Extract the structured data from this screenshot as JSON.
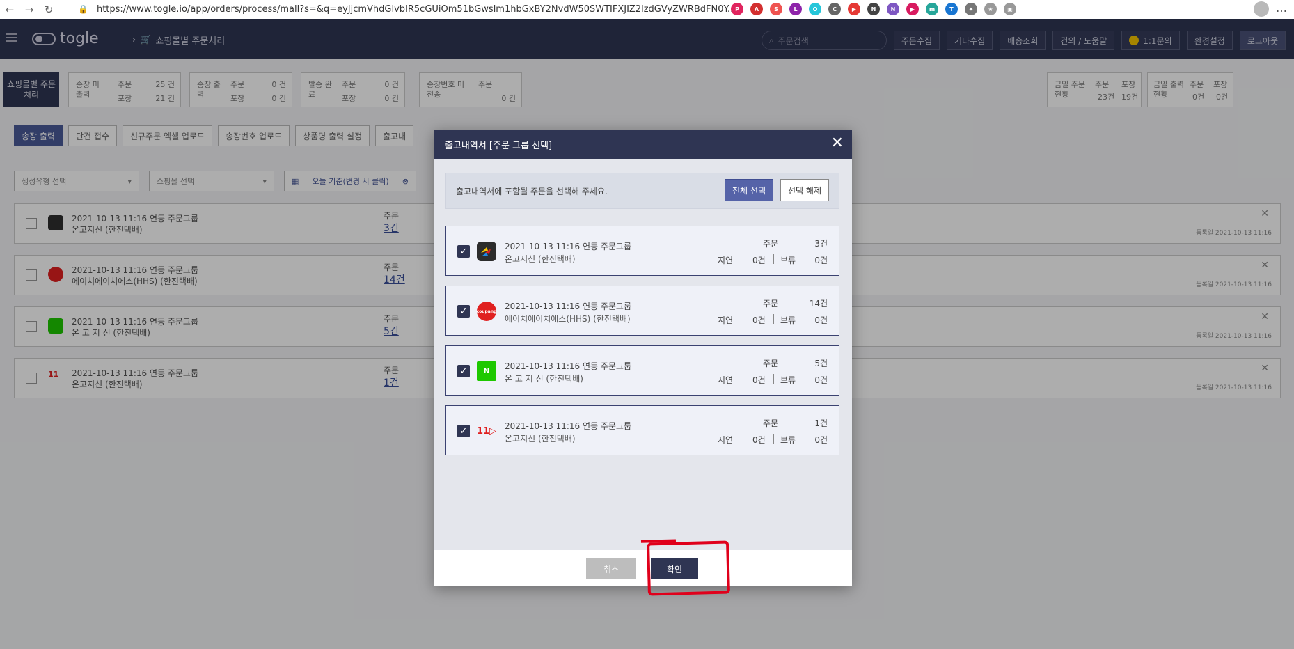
{
  "browser": {
    "url": "https://www.togle.io/app/orders/process/mall?s=&q=eyJjcmVhdGlvbIR5cGUiOm51bGwslm1hbGxBY2NvdW50SWTIFXJIZ2lzdGVyZWRBdFN0Y..."
  },
  "header": {
    "logo": "togle",
    "breadcrumb": "쇼핑몰별 주문처리",
    "search_placeholder": "주문검색",
    "buttons": [
      "주문수집",
      "기타수집",
      "배송조회",
      "건의 / 도움말",
      "1:1문의",
      "환경설정",
      "로그아웃"
    ]
  },
  "status": {
    "main_label": "쇼핑몰별 주문처리",
    "cards": [
      {
        "label": "송장 미출력",
        "r1_label": "주문",
        "r1_value": "25 건",
        "r2_label": "포장",
        "r2_value": "21 건"
      },
      {
        "label": "송장 출력",
        "r1_label": "주문",
        "r1_value": "0 건",
        "r2_label": "포장",
        "r2_value": "0 건"
      },
      {
        "label": "발송 완료",
        "r1_label": "주문",
        "r1_value": "0 건",
        "r2_label": "포장",
        "r2_value": "0 건"
      },
      {
        "label": "송장번호 미전송",
        "r1_label": "주문",
        "r1_value": "0 건"
      }
    ],
    "today_order": {
      "label": "금일 주문 현황",
      "order_label": "주문",
      "order_value": "23건",
      "pack_label": "포장",
      "pack_value": "19건"
    },
    "today_print": {
      "label": "금일 출력 현황",
      "order_label": "주문",
      "order_value": "0건",
      "pack_label": "포장",
      "pack_value": "0건"
    }
  },
  "toolbar": [
    "송장 출력",
    "단건 접수",
    "신규주문 엑셀 업로드",
    "송장번호 업로드",
    "상품명 출력 설정",
    "출고내"
  ],
  "filters": {
    "type_select": "생성유형 선택",
    "mall_select": "쇼핑몰 선택",
    "date": "오늘 기준(변경 시 클릭)"
  },
  "background_list": [
    {
      "date": "2021-10-13 11:16 연동 주문그룹",
      "carrier": "온고지신 (한진택배)",
      "count_label": "주문",
      "count": "3건",
      "registered": "등록일 2021-10-13 11:16"
    },
    {
      "date": "2021-10-13 11:16 연동 주문그룹",
      "carrier": "에이치에이치에스(HHS) (한진택배)",
      "count_label": "주문",
      "count": "14건",
      "registered": "등록일 2021-10-13 11:16"
    },
    {
      "date": "2021-10-13 11:16 연동 주문그룹",
      "carrier": "온 고 지 신 (한진택배)",
      "count_label": "주문",
      "count": "5건",
      "registered": "등록일 2021-10-13 11:16"
    },
    {
      "date": "2021-10-13 11:16 연동 주문그룹",
      "carrier": "온고지신 (한진택배)",
      "count_label": "주문",
      "count": "1건",
      "registered": "등록일 2021-10-13 11:16"
    }
  ],
  "modal": {
    "title": "출고내역서 [주문 그룹 선택]",
    "instruction": "출고내역서에 포함될 주문을 선택해 주세요.",
    "select_all": "전체 선택",
    "deselect": "선택 해제",
    "cancel": "취소",
    "confirm": "확인",
    "groups": [
      {
        "mall_icon": "gmarket-logo",
        "date": "2021-10-13 11:16 연동 주문그룹",
        "carrier": "온고지신 (한진택배)",
        "order_label": "주문",
        "order_value": "3건",
        "delay_label": "지연",
        "delay_value": "0건",
        "hold_label": "보류",
        "hold_value": "0건"
      },
      {
        "mall_icon": "coupang-logo",
        "date": "2021-10-13 11:16 연동 주문그룹",
        "carrier": "에이치에이치에스(HHS) (한진택배)",
        "order_label": "주문",
        "order_value": "14건",
        "delay_label": "지연",
        "delay_value": "0건",
        "hold_label": "보류",
        "hold_value": "0건"
      },
      {
        "mall_icon": "naver-logo",
        "date": "2021-10-13 11:16 연동 주문그룹",
        "carrier": "온 고 지 신 (한진택배)",
        "order_label": "주문",
        "order_value": "5건",
        "delay_label": "지연",
        "delay_value": "0건",
        "hold_label": "보류",
        "hold_value": "0건"
      },
      {
        "mall_icon": "11st-logo",
        "date": "2021-10-13 11:16 연동 주문그룹",
        "carrier": "온고지신 (한진택배)",
        "order_label": "주문",
        "order_value": "1건",
        "delay_label": "지연",
        "delay_value": "0건",
        "hold_label": "보류",
        "hold_value": "0건"
      }
    ]
  },
  "mall_logo_text": {
    "coupang": "coupang",
    "naver": "N",
    "elevenst": "11"
  },
  "colors": {
    "primary": "#2f3553",
    "accent": "#5563a8",
    "annotation": "#e0001b"
  }
}
